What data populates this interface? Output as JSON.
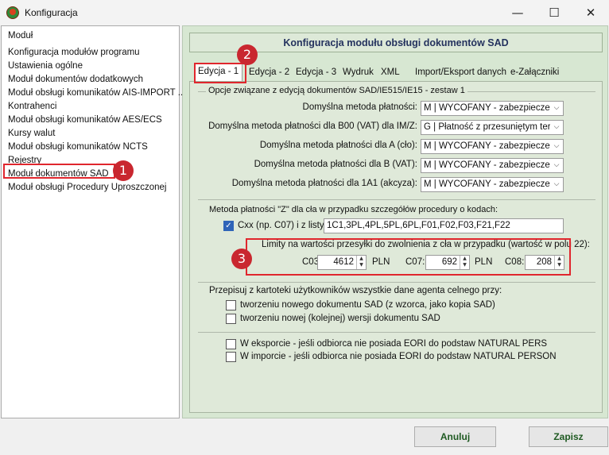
{
  "window": {
    "title": "Konfiguracja",
    "minimize_label": "—",
    "maximize_label": "☐",
    "close_label": "✕",
    "accent": "#e0262d"
  },
  "nav": {
    "items": [
      "Moduł",
      "Konfiguracja modułów programu",
      "Ustawienia ogólne",
      "Moduł dokumentów dodatkowych",
      "Moduł obsługi komunikatów AIS-IMPORT ...",
      "Kontrahenci",
      "Moduł obsługi komunikatów AES/ECS",
      "Kursy walut",
      "Moduł obsługi komunikatów NCTS",
      "Rejestry",
      "Moduł dokumentów SAD",
      "Moduł obsługi Procedury Uproszczonej"
    ],
    "selected_index": 10
  },
  "panel": {
    "title": "Konfiguracja modułu obsługi dokumentów SAD",
    "tabs": [
      "Edycja - 1",
      "Edycja - 2",
      "Edycja - 3",
      "Wydruk",
      "XML",
      "Import/Eksport danych",
      "e-Załączniki"
    ],
    "active_tab": 0
  },
  "group1": {
    "title": "Opcje związane z edycją dokumentów SAD/IE515/IE15 - zestaw 1",
    "rows": [
      {
        "label": "Domyślna metoda płatności:",
        "value": "M | WYCOFANY - zabezpieczenie"
      },
      {
        "label": "Domyślna metoda płatności dla B00 (VAT) dla IM/Z:",
        "value": "G | Płatność z przesuniętym termi"
      },
      {
        "label": "Domyślna metoda płatności dla A (cło):",
        "value": "M | WYCOFANY - zabezpieczenie"
      },
      {
        "label": "Domyślna metoda płatności dla B (VAT):",
        "value": "M | WYCOFANY - zabezpieczenie"
      },
      {
        "label": "Domyślna metoda płatności dla 1A1 (akcyza):",
        "value": "M | WYCOFANY - zabezpieczenie"
      }
    ]
  },
  "group2": {
    "title": "Metoda płatności \"Z\" dla cła w przypadku szczegółów procedury o kodach:",
    "cxx_label": "Cxx (np. C07)  i z listy:",
    "cxx_checked": true,
    "codes": "1C1,3PL,4PL,5PL,6PL,F01,F02,F03,F21,F22",
    "limits_title": "Limity na wartości przesyłki do zwolnienia z cła w przypadku (wartość w polu 22):",
    "limits": [
      {
        "code": "C03:",
        "value": "4612",
        "currency": "PLN"
      },
      {
        "code": "C07:",
        "value": "692",
        "currency": "PLN"
      },
      {
        "code": "C08:",
        "value": "208",
        "currency": ""
      }
    ]
  },
  "group3": {
    "title": "Przepisuj z kartoteki użytkowników wszystkie dane agenta celnego przy:",
    "options": [
      {
        "label": "tworzeniu nowego dokumentu SAD (z wzorca, jako kopia SAD)",
        "checked": false
      },
      {
        "label": "tworzeniu nowej (kolejnej) wersji dokumentu SAD",
        "checked": false
      }
    ]
  },
  "group4": {
    "options": [
      {
        "label": "W eksporcie - jeśli odbiorca nie posiada EORI do podstaw NATURAL PERS",
        "checked": false
      },
      {
        "label": "W imporcie - jeśli odbiorca nie posiada EORI do podstaw NATURAL PERSON",
        "checked": false
      }
    ]
  },
  "annotations": [
    "1",
    "2",
    "3"
  ],
  "footer": {
    "cancel_label": "Anuluj",
    "save_label": "Zapisz"
  }
}
